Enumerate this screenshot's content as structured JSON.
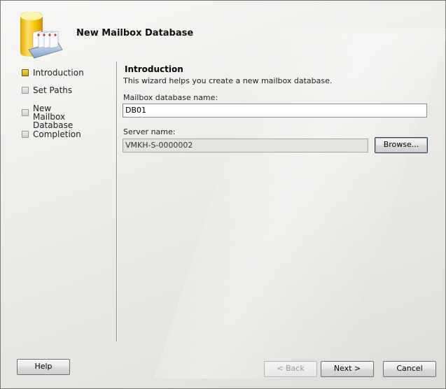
{
  "header": {
    "title": "New Mailbox Database",
    "icon": "mailbox-database-icon"
  },
  "steps": [
    {
      "label": "Introduction",
      "active": true
    },
    {
      "label": "Set Paths",
      "active": false
    },
    {
      "label": "New Mailbox Database",
      "active": false
    },
    {
      "label": "Completion",
      "active": false
    }
  ],
  "main": {
    "section_title": "Introduction",
    "description": "This wizard helps you create a new mailbox database.",
    "db_name_label": "Mailbox database name:",
    "db_name_value": "DB01",
    "server_label": "Server name:",
    "server_value": "VMKH-S-0000002",
    "browse_label": "Browse..."
  },
  "footer": {
    "help_label": "Help",
    "back_label": "< Back",
    "next_label": "Next >",
    "cancel_label": "Cancel"
  },
  "colors": {
    "active_step": "#e0b82a",
    "window_bg": "#efeeeb"
  }
}
